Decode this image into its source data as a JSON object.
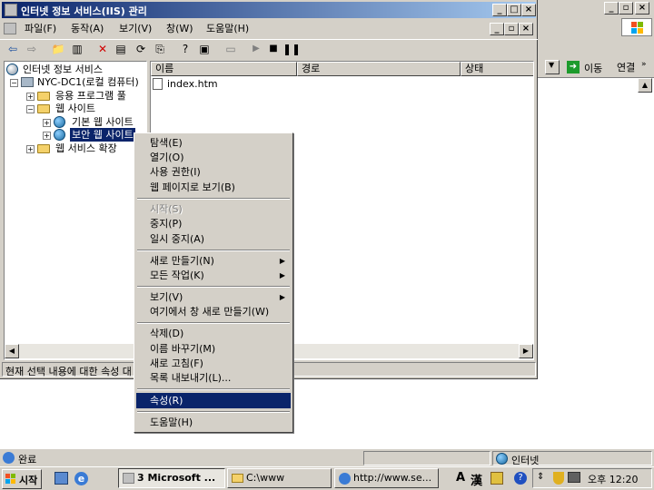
{
  "bg_window": {
    "address_go_label": "이동",
    "links_label": "연결",
    "status_text": "완료",
    "zone_text": "인터넷"
  },
  "mmc": {
    "title": "인터넷 정보 서비스(IIS) 관리",
    "menu": [
      "파일(F)",
      "동작(A)",
      "보기(V)",
      "창(W)",
      "도움말(H)"
    ],
    "tree": {
      "root": "인터넷 정보 서비스",
      "server": "NYC-DC1(로컬 컴퓨터)",
      "app_pools": "응용 프로그램 풀",
      "web_sites": "웹 사이트",
      "default_site": "기본 웹 사이트",
      "secure_site": "보안 웹 사이트",
      "web_service_ext": "웹 서비스 확장"
    },
    "columns": [
      "이름",
      "경로",
      "상태"
    ],
    "files": [
      "index.htm"
    ],
    "status_text": "현재 선택 내용에 대한 속성 대"
  },
  "context_menu": {
    "items": [
      {
        "label": "탐색(E)",
        "disabled": false
      },
      {
        "label": "열기(O)",
        "disabled": false
      },
      {
        "label": "사용 권한(I)",
        "disabled": false
      },
      {
        "label": "웹 페이지로 보기(B)",
        "disabled": false
      },
      {
        "label": "시작(S)",
        "disabled": true
      },
      {
        "label": "중지(P)",
        "disabled": false
      },
      {
        "label": "일시 중지(A)",
        "disabled": false
      },
      {
        "label": "새로 만들기(N)",
        "disabled": false
      },
      {
        "label": "모든 작업(K)",
        "disabled": false
      },
      {
        "label": "보기(V)",
        "disabled": false
      },
      {
        "label": "여기에서 창 새로 만들기(W)",
        "disabled": false
      },
      {
        "label": "삭제(D)",
        "disabled": false
      },
      {
        "label": "이름 바꾸기(M)",
        "disabled": false
      },
      {
        "label": "새로 고침(F)",
        "disabled": false
      },
      {
        "label": "목록 내보내기(L)...",
        "disabled": false
      },
      {
        "label": "속성(R)",
        "disabled": false
      },
      {
        "label": "도움말(H)",
        "disabled": false
      }
    ]
  },
  "taskbar": {
    "start_label": "시작",
    "buttons": [
      "3 Microsoft ...",
      "C:\\www",
      "http://www.se..."
    ],
    "ime": [
      "A",
      "漢"
    ],
    "clock": "오후 12:20"
  }
}
